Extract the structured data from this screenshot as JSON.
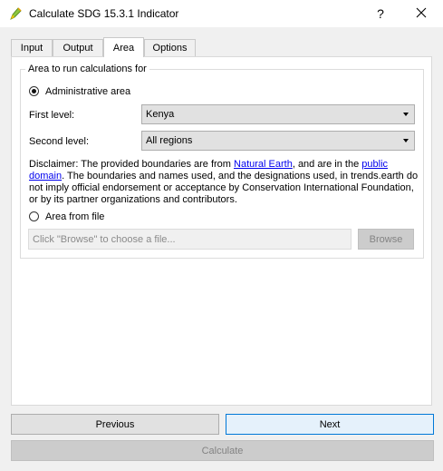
{
  "window": {
    "title": "Calculate SDG 15.3.1 Indicator",
    "help_label": "?",
    "app_icon": "pencil-leaf-icon",
    "close_icon": "close-icon"
  },
  "tabs": [
    {
      "label": "Input"
    },
    {
      "label": "Output"
    },
    {
      "label": "Area",
      "active": true
    },
    {
      "label": "Options"
    }
  ],
  "area": {
    "group_title": "Area to run calculations for",
    "admin_option": {
      "label": "Administrative area",
      "selected": true
    },
    "first_level": {
      "label": "First level:",
      "value": "Kenya"
    },
    "second_level": {
      "label": "Second level:",
      "value": "All regions"
    },
    "disclaimer": {
      "prefix": "Disclaimer: The provided boundaries are from ",
      "link1": "Natural Earth",
      "middle": ", and are in the ",
      "link2": "public domain",
      "suffix": ". The boundaries and names used, and the designations used, in trends.earth do not imply official endorsement or acceptance by Conservation International Foundation, or by its partner organizations and contributors."
    },
    "file_option": {
      "label": "Area from file",
      "selected": false
    },
    "file_input": {
      "placeholder": "Click \"Browse\" to choose a file..."
    },
    "browse_label": "Browse"
  },
  "footer": {
    "previous_label": "Previous",
    "next_label": "Next",
    "calculate_label": "Calculate"
  },
  "colors": {
    "link": "#0000ee",
    "focus_border": "#0078d7",
    "next_bg": "#e5f1fb",
    "dialog_bg": "#f0f0f0"
  }
}
